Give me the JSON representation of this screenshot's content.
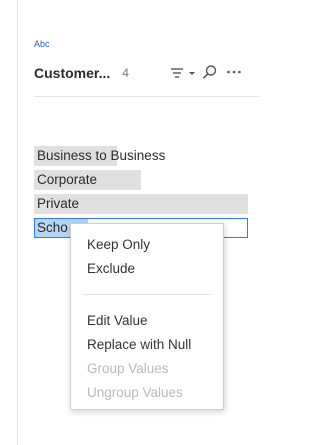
{
  "field": {
    "type_label": "Abc",
    "name": "Customer...",
    "count": "4",
    "icons": {
      "sort": "sort-icon",
      "chevron": "chevron-down-icon",
      "search": "search-icon",
      "more": "more-icon"
    }
  },
  "values": [
    {
      "label": "Business to Business",
      "bar_fraction": 0.39,
      "selected": false
    },
    {
      "label": "Corporate",
      "bar_fraction": 0.5,
      "selected": false
    },
    {
      "label": "Private",
      "bar_fraction": 1.0,
      "selected": false
    },
    {
      "label": "Scho",
      "bar_fraction": 0.25,
      "selected": true
    }
  ],
  "context_menu": {
    "items": [
      {
        "label": "Keep Only",
        "enabled": true
      },
      {
        "label": "Exclude",
        "enabled": true
      },
      {
        "label": "Edit Value",
        "enabled": true
      },
      {
        "label": "Replace with Null",
        "enabled": true
      },
      {
        "label": "Group Values",
        "enabled": false
      },
      {
        "label": "Ungroup Values",
        "enabled": false
      }
    ]
  },
  "colors": {
    "type_label": "#1f5fbf",
    "bar": "#e0e0e0",
    "selected_bar": "#b7d3f2",
    "selection_outline": "#2f7ed8",
    "disabled_text": "#b9b9b9"
  }
}
